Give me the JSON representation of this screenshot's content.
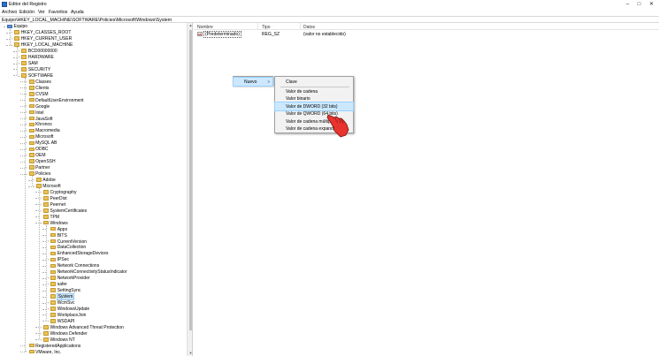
{
  "window": {
    "title": "Editor del Registro",
    "controls": {
      "minimize": "–",
      "maximize": "□",
      "close": "✕"
    }
  },
  "menu": [
    "Archivo",
    "Edición",
    "Ver",
    "Favoritos",
    "Ayuda"
  ],
  "address": "Equipo\\HKEY_LOCAL_MACHINE\\SOFTWARE\\Policies\\Microsoft\\Windows\\System",
  "tree": [
    {
      "label": "Equipo",
      "level": 0,
      "exp": "v",
      "icon": "pc"
    },
    {
      "label": "HKEY_CLASSES_ROOT",
      "level": 1,
      "exp": ">"
    },
    {
      "label": "HKEY_CURRENT_USER",
      "level": 1,
      "exp": ">"
    },
    {
      "label": "HKEY_LOCAL_MACHINE",
      "level": 1,
      "exp": "v"
    },
    {
      "label": "BCD00000000",
      "level": 2,
      "exp": ">"
    },
    {
      "label": "HARDWARE",
      "level": 2,
      "exp": ">"
    },
    {
      "label": "SAM",
      "level": 2,
      "exp": ">"
    },
    {
      "label": "SECURITY",
      "level": 2,
      "exp": ""
    },
    {
      "label": "SOFTWARE",
      "level": 2,
      "exp": "v"
    },
    {
      "label": "Classes",
      "level": 3,
      "exp": ">"
    },
    {
      "label": "Clients",
      "level": 3,
      "exp": ">"
    },
    {
      "label": "CVSM",
      "level": 3,
      "exp": ">"
    },
    {
      "label": "DefaultUserEnvironment",
      "level": 3,
      "exp": ""
    },
    {
      "label": "Google",
      "level": 3,
      "exp": ">"
    },
    {
      "label": "Intel",
      "level": 3,
      "exp": ">"
    },
    {
      "label": "JavaSoft",
      "level": 3,
      "exp": ">"
    },
    {
      "label": "Khronos",
      "level": 3,
      "exp": ">"
    },
    {
      "label": "Macromedia",
      "level": 3,
      "exp": ">"
    },
    {
      "label": "Microsoft",
      "level": 3,
      "exp": ">"
    },
    {
      "label": "MySQL AB",
      "level": 3,
      "exp": ">"
    },
    {
      "label": "ODBC",
      "level": 3,
      "exp": ">"
    },
    {
      "label": "OEM",
      "level": 3,
      "exp": ">"
    },
    {
      "label": "OpenSSH",
      "level": 3,
      "exp": ""
    },
    {
      "label": "Partner",
      "level": 3,
      "exp": ">"
    },
    {
      "label": "Policies",
      "level": 3,
      "exp": "v"
    },
    {
      "label": "Adobe",
      "level": 4,
      "exp": ">"
    },
    {
      "label": "Microsoft",
      "level": 4,
      "exp": "v"
    },
    {
      "label": "Cryptography",
      "level": 5,
      "exp": ">"
    },
    {
      "label": "PeerDist",
      "level": 5,
      "exp": ">"
    },
    {
      "label": "Peernet",
      "level": 5,
      "exp": ">"
    },
    {
      "label": "SystemCertificates",
      "level": 5,
      "exp": ">"
    },
    {
      "label": "TPM",
      "level": 5,
      "exp": ""
    },
    {
      "label": "Windows",
      "level": 5,
      "exp": "v"
    },
    {
      "label": "Appx",
      "level": 6,
      "exp": ""
    },
    {
      "label": "BITS",
      "level": 6,
      "exp": ""
    },
    {
      "label": "CurrentVersion",
      "level": 6,
      "exp": ">"
    },
    {
      "label": "DataCollection",
      "level": 6,
      "exp": ""
    },
    {
      "label": "EnhancedStorageDevices",
      "level": 6,
      "exp": ""
    },
    {
      "label": "IPSec",
      "level": 6,
      "exp": ">"
    },
    {
      "label": "Network Connections",
      "level": 6,
      "exp": ""
    },
    {
      "label": "NetworkConnectivityStatusIndicator",
      "level": 6,
      "exp": ""
    },
    {
      "label": "NetworkProvider",
      "level": 6,
      "exp": ">"
    },
    {
      "label": "safer",
      "level": 6,
      "exp": ">"
    },
    {
      "label": "SettingSync",
      "level": 6,
      "exp": ""
    },
    {
      "label": "System",
      "level": 6,
      "exp": "",
      "selected": true
    },
    {
      "label": "WcmSvc",
      "level": 6,
      "exp": ">"
    },
    {
      "label": "WindowsUpdate",
      "level": 6,
      "exp": ">"
    },
    {
      "label": "WorkplaceJoin",
      "level": 6,
      "exp": ""
    },
    {
      "label": "WSDAPI",
      "level": 6,
      "exp": ">"
    },
    {
      "label": "Windows Advanced Threat Protection",
      "level": 5,
      "exp": ">"
    },
    {
      "label": "Windows Defender",
      "level": 5,
      "exp": ">"
    },
    {
      "label": "Windows NT",
      "level": 5,
      "exp": ">"
    },
    {
      "label": "RegisteredApplications",
      "level": 3,
      "exp": ""
    },
    {
      "label": "VMware, Inc.",
      "level": 3,
      "exp": ">"
    }
  ],
  "columns": {
    "name": "Nombre",
    "type": "Tipo",
    "data": "Datos"
  },
  "values": [
    {
      "icon_text": "ab",
      "name": "(Predeterminado)",
      "type": "REG_SZ",
      "data": "(valor no establecido)"
    }
  ],
  "context_menu": {
    "parent": {
      "label": "Nuevo",
      "arrow": ">"
    },
    "items": [
      "Clave",
      "Valor de cadena",
      "Valor binario",
      "Valor de DWORD (32 bits)",
      "Valor de QWORD (64 bits)",
      "Valor de cadena múltiple",
      "Valor de cadena expandible"
    ],
    "highlighted_index": 3
  },
  "colors": {
    "folder": "#e9c25a",
    "selection": "#cce4f7",
    "menu_highlight": "#cce8ff",
    "pointer_hand": "#e8332e"
  }
}
